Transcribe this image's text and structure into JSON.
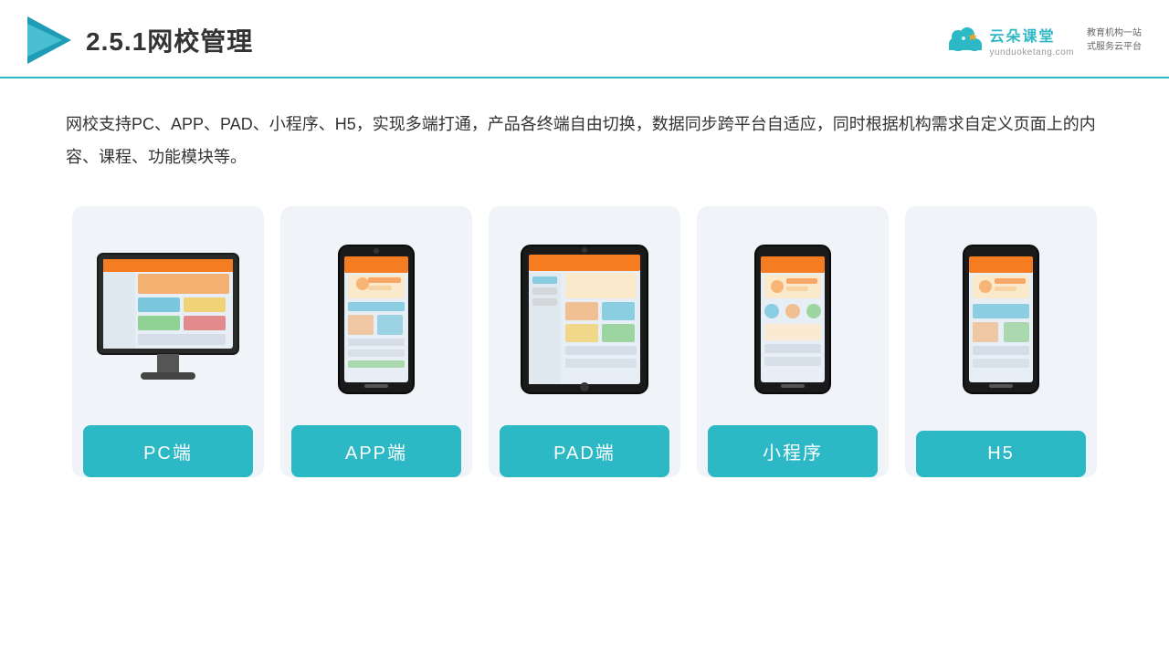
{
  "header": {
    "title": "2.5.1网校管理",
    "brand_name": "云朵课堂",
    "brand_url": "yunduoketang.com",
    "brand_slogan": "教育机构一站\n式服务云平台"
  },
  "description": {
    "text": "网校支持PC、APP、PAD、小程序、H5，实现多端打通，产品各终端自由切换，数据同步跨平台自适应，同时根据机构需求自定义页面上的内容、课程、功能模块等。"
  },
  "cards": [
    {
      "label": "PC端",
      "type": "pc"
    },
    {
      "label": "APP端",
      "type": "phone"
    },
    {
      "label": "PAD端",
      "type": "tablet"
    },
    {
      "label": "小程序",
      "type": "phone2"
    },
    {
      "label": "H5",
      "type": "phone3"
    }
  ]
}
